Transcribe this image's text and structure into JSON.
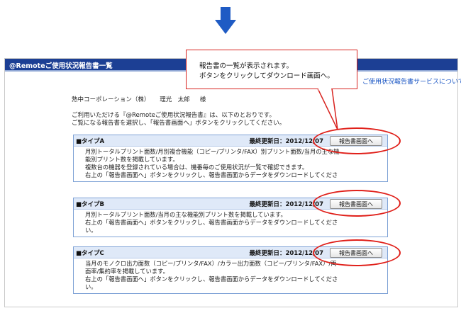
{
  "window": {
    "title": "@Remoteご使用状況報告書一覧"
  },
  "links": {
    "service": "ご使用状況報告書サービスについて"
  },
  "greeting": {
    "company": "熱中コーポレーション（株）",
    "name": "理光　太郎",
    "honorific": "様"
  },
  "intro": {
    "line1": "ご利用いただける『@Remoteご使用状況報告書』は、以下のとおりです。",
    "line2": "ご覧になる報告書を選択し、「報告書画面へ」ボタンをクリックしてください。"
  },
  "date_label": "最終更新日：",
  "report_button_label": "報告書画面へ",
  "reports": [
    {
      "title": "■タイプA",
      "updated": "2012/12/07",
      "lines": [
        "月別トータルプリント面数/月別複合機能（コピー/プリンタ/FAX）別プリント面数/当月の主な機",
        "能別プリント数を掲載しています。",
        "複数台の機器を登録されている場合は、機番毎のご使用状況が一覧で確認できます。",
        "右上の「報告書画面へ」ボタンをクリックし、報告書画面からデータをダウンロードしてくださ"
      ]
    },
    {
      "title": "■タイプB",
      "updated": "2012/12/07",
      "lines": [
        "月別トータルプリント面数/当月の主な機能別プリント数を掲載しています。",
        "右上の「報告書画面へ」ボタンをクリックし、報告書画面からデータをダウンロードしてくださ",
        "い。"
      ]
    },
    {
      "title": "■タイプC",
      "updated": "2012/12/07",
      "lines": [
        "当月のモノクロ出力面数（コピー/プリンタ/FAX）/カラー出力面数（コピー/プリンタ/FAX）/両",
        "面率/集約率を掲載しています。",
        "右上の「報告書画面へ」ボタンをクリックし、報告書画面からデータをダウンロードしてくださ",
        "い。"
      ]
    }
  ],
  "callout": {
    "line1": "報告書の一覧が表示されます。",
    "line2": "ボタンをクリックしてダウンロード画面へ。"
  },
  "colors": {
    "title_bar": "#1c3f94",
    "arrow": "#1f5bc4",
    "card_border": "#7fa3d6",
    "card_header": "#dfe9f8",
    "highlight": "#e0201a"
  }
}
